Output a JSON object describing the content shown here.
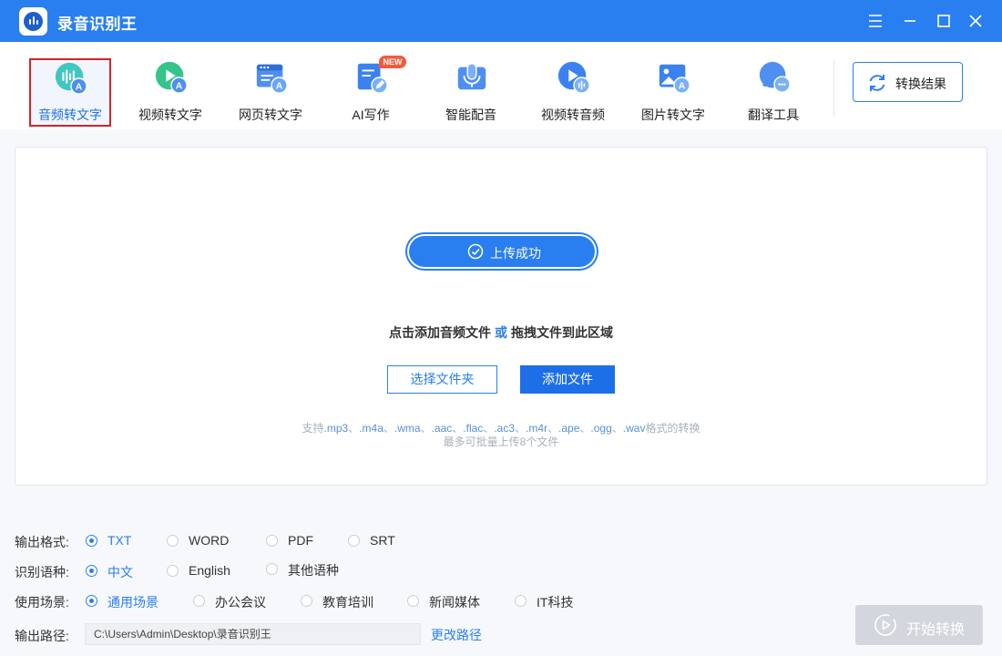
{
  "app": {
    "title": "录音识别王"
  },
  "window_controls": [
    "menu-icon",
    "minimize-icon",
    "maximize-icon",
    "close-icon"
  ],
  "toolbar": {
    "tools": [
      {
        "label": "音频转文字",
        "icon": "audio-to-text-icon",
        "active": true
      },
      {
        "label": "视频转文字",
        "icon": "video-to-text-icon",
        "active": false
      },
      {
        "label": "网页转文字",
        "icon": "webpage-to-text-icon",
        "active": false
      },
      {
        "label": "AI写作",
        "icon": "ai-writing-icon",
        "active": false,
        "badge": "NEW"
      },
      {
        "label": "智能配音",
        "icon": "smart-dubbing-icon",
        "active": false
      },
      {
        "label": "视频转音频",
        "icon": "video-to-audio-icon",
        "active": false
      },
      {
        "label": "图片转文字",
        "icon": "image-to-text-icon",
        "active": false
      },
      {
        "label": "翻译工具",
        "icon": "translate-icon",
        "active": false
      }
    ],
    "result_button": "转换结果"
  },
  "upload": {
    "status": "上传成功",
    "hint_prefix": "点击添加音频文件",
    "hint_or": "或",
    "hint_suffix": "拖拽文件到此区域",
    "select_folder": "选择文件夹",
    "add_file": "添加文件",
    "support_prefix": "支持",
    "formats": [
      ".mp3",
      ".m4a",
      ".wma",
      ".aac",
      ".flac",
      ".ac3",
      ".m4r",
      ".ape",
      ".ogg",
      ".wav"
    ],
    "support_suffix": "格式的转换",
    "limit": "最多可批量上传8个文件"
  },
  "options": {
    "output_format": {
      "label": "输出格式:",
      "choices": [
        "TXT",
        "WORD",
        "PDF",
        "SRT"
      ],
      "selected": "TXT"
    },
    "language": {
      "label": "识别语种:",
      "choices": [
        "中文",
        "English",
        "其他语种"
      ],
      "selected": "中文"
    },
    "scene": {
      "label": "使用场景:",
      "choices": [
        "通用场景",
        "办公会议",
        "教育培训",
        "新闻媒体",
        "IT科技"
      ],
      "selected": "通用场景"
    },
    "output_path": {
      "label": "输出路径:",
      "value": "C:\\Users\\Admin\\Desktop\\录音识别王",
      "change": "更改路径"
    }
  },
  "start_button": "开始转换",
  "colors": {
    "accent": "#2a7ff0",
    "titlebar": "#2a7ff0",
    "highlight": "#d2242a",
    "disabled": "#d3d7dd"
  }
}
